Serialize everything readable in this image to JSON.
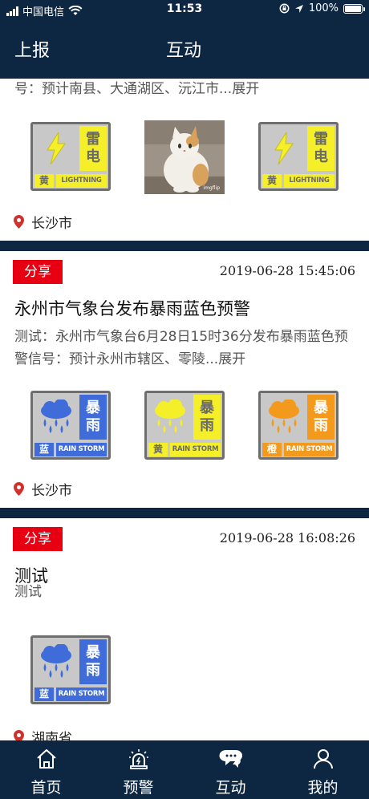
{
  "status": {
    "carrier": "中国电信",
    "time": "11:53",
    "battery": "100%"
  },
  "nav": {
    "back_label": "上报",
    "title": "互动"
  },
  "posts": [
    {
      "desc_tail": "号：预计南县、大通湖区、沅江市...展开",
      "images": [
        {
          "type": "lightning",
          "level": "黄",
          "chars": [
            "雷",
            "电"
          ],
          "english": "LIGHTNING",
          "color": "yellow"
        },
        {
          "type": "photo",
          "watermark": "imgflip"
        },
        {
          "type": "lightning",
          "level": "黄",
          "chars": [
            "雷",
            "电"
          ],
          "english": "LIGHTNING",
          "color": "yellow"
        }
      ],
      "location": "长沙市"
    },
    {
      "share_label": "分享",
      "time": "2019-06-28 15:45:06",
      "title": "永州市气象台发布暴雨蓝色预警",
      "desc": "测试：永州市气象台6月28日15时36分发布暴雨蓝色预警信号：预计永州市辖区、零陵...展开",
      "images": [
        {
          "type": "rainstorm",
          "level": "蓝",
          "chars": [
            "暴",
            "雨"
          ],
          "english": "RAIN STORM",
          "color": "blue"
        },
        {
          "type": "rainstorm",
          "level": "黄",
          "chars": [
            "暴",
            "雨"
          ],
          "english": "RAIN STORM",
          "color": "yellow"
        },
        {
          "type": "rainstorm",
          "level": "橙",
          "chars": [
            "暴",
            "雨"
          ],
          "english": "RAIN STORM",
          "color": "orange"
        }
      ],
      "location": "长沙市"
    },
    {
      "share_label": "分享",
      "time": "2019-06-28 16:08:26",
      "title": "测试",
      "desc": "测试",
      "images": [
        {
          "type": "rainstorm",
          "level": "蓝",
          "chars": [
            "暴",
            "雨"
          ],
          "english": "RAIN STORM",
          "color": "blue"
        }
      ],
      "location": "湖南省"
    }
  ],
  "tabs": [
    {
      "label": "首页",
      "icon": "home-icon"
    },
    {
      "label": "预警",
      "icon": "alarm-icon"
    },
    {
      "label": "互动",
      "icon": "chat-bubbles-icon",
      "active": true
    },
    {
      "label": "我的",
      "icon": "user-icon"
    }
  ],
  "colors": {
    "navy": "#0d2642",
    "share_red": "#e60012",
    "pin_red": "#d0312d",
    "yellow": "#f5ef2a",
    "blue": "#3f6cd9",
    "orange": "#f39a1d"
  }
}
